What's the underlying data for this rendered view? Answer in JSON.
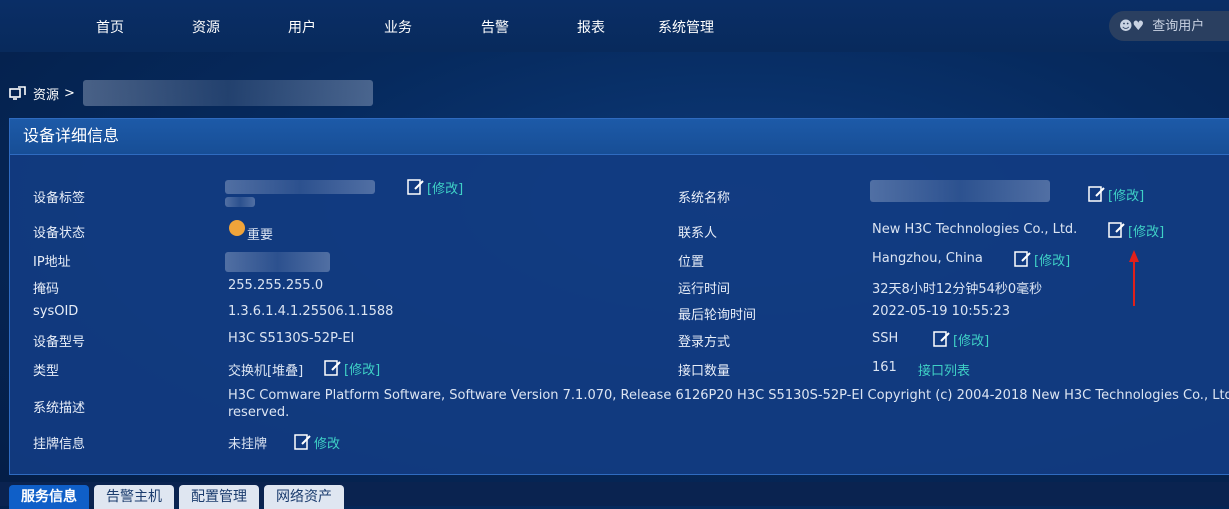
{
  "nav": {
    "items": [
      {
        "label": "首页",
        "name": "nav-home"
      },
      {
        "label": "资源",
        "name": "nav-resources"
      },
      {
        "label": "用户",
        "name": "nav-users"
      },
      {
        "label": "业务",
        "name": "nav-business"
      },
      {
        "label": "告警",
        "name": "nav-alarms"
      },
      {
        "label": "报表",
        "name": "nav-reports"
      },
      {
        "label": "系统管理",
        "name": "nav-system-admin"
      }
    ],
    "search_placeholder": "查询用户"
  },
  "breadcrumb": {
    "root": "资源",
    "separator": ">"
  },
  "panel": {
    "title": "设备详细信息",
    "edit_label": "[修改]",
    "edit_label_plain": "修改",
    "left": {
      "device_label": "设备标签",
      "device_status": "设备状态",
      "status_value": "重要",
      "ip": "IP地址",
      "mask": "掩码",
      "mask_value": "255.255.255.0",
      "sysoid": "sysOID",
      "sysoid_value": "1.3.6.1.4.1.25506.1.1588",
      "model": "设备型号",
      "model_value": "H3C S5130S-52P-EI",
      "type": "类型",
      "type_value": "交换机[堆叠]",
      "desc": "系统描述",
      "desc_value_line1": "H3C Comware Platform Software, Software Version 7.1.070, Release 6126P20 H3C S5130S-52P-EI Copyright (c) 2004-2018 New H3C Technologies Co., Ltd. A",
      "desc_value_line2": "reserved.",
      "tag": "挂牌信息",
      "tag_value": "未挂牌"
    },
    "right": {
      "sys_name": "系统名称",
      "contact": "联系人",
      "contact_value": "New H3C Technologies Co., Ltd.",
      "location": "位置",
      "location_value": "Hangzhou, China",
      "uptime": "运行时间",
      "uptime_value": "32天8小时12分钟54秒0毫秒",
      "last_poll": "最后轮询时间",
      "last_poll_value": "2022-05-19 10:55:23",
      "login": "登录方式",
      "login_value": "SSH",
      "iface_count": "接口数量",
      "iface_count_value": "161",
      "iface_list": "接口列表"
    }
  },
  "tabs": [
    {
      "label": "服务信息",
      "active": true
    },
    {
      "label": "告警主机",
      "active": false
    },
    {
      "label": "配置管理",
      "active": false
    },
    {
      "label": "网络资产",
      "active": false
    }
  ],
  "colors": {
    "accent": "#3fd1c6",
    "status_orange": "#f0a43a",
    "arrow": "#e0201a"
  }
}
